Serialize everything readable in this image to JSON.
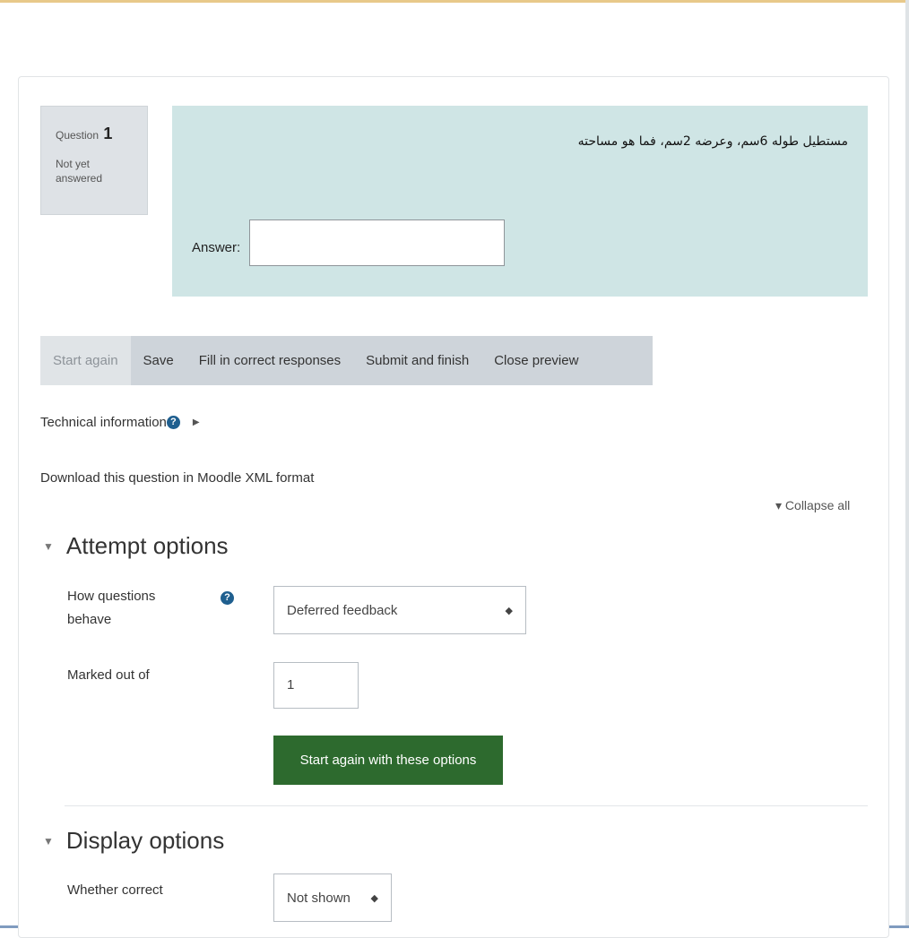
{
  "question_info": {
    "label": "Question",
    "number": "1",
    "state": "Not yet answered"
  },
  "formulation": {
    "question_text": "مستطيل طوله 6سم، وعرضه 2سم، فما هو مساحته",
    "answer_label": "Answer:",
    "answer_value": ""
  },
  "controls": {
    "start_again": "Start again",
    "save": "Save",
    "fill_correct": "Fill in correct responses",
    "submit_finish": "Submit and finish",
    "close_preview": "Close preview"
  },
  "links": {
    "technical_information": "Technical information",
    "download": "Download this question in Moodle XML format",
    "collapse_all": "Collapse all"
  },
  "attempt_options": {
    "heading": "Attempt options",
    "how_behave_label": "How questions behave",
    "how_behave_value": "Deferred feedback",
    "marked_out_of_label": "Marked out of",
    "marked_out_of_value": "1",
    "start_again_button": "Start again with these options"
  },
  "display_options": {
    "heading": "Display options",
    "whether_correct_label": "Whether correct",
    "whether_correct_value": "Not shown"
  },
  "icons": {
    "help": "question-circle-icon",
    "expand": "caret-right-icon",
    "collapse": "caret-down-icon"
  },
  "colors": {
    "formulation_bg": "#cfe5e5",
    "info_bg": "#dee2e6",
    "controls_bg": "#ced4da",
    "primary_button": "#2d6a2e"
  }
}
